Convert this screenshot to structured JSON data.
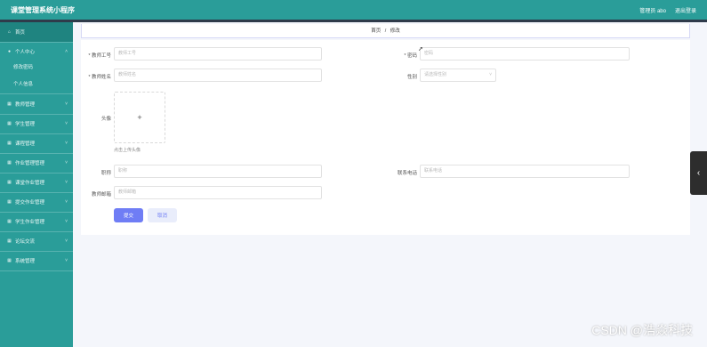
{
  "topbar": {
    "title": "课堂管理系统小程序",
    "admin_label": "管理员 abo",
    "logout_label": "退出登录"
  },
  "sidebar": {
    "items": [
      {
        "label": "首页",
        "icon": "home-icon"
      },
      {
        "label": "个人中心",
        "icon": "user-icon"
      },
      {
        "label": "修改密码"
      },
      {
        "label": "个人信息"
      },
      {
        "label": "教师管理",
        "icon": "grid-icon"
      },
      {
        "label": "学生管理",
        "icon": "grid-icon"
      },
      {
        "label": "课程管理",
        "icon": "grid-icon"
      },
      {
        "label": "作业管理管理",
        "icon": "grid-icon"
      },
      {
        "label": "课堂作业管理",
        "icon": "grid-icon"
      },
      {
        "label": "提交作业管理",
        "icon": "grid-icon"
      },
      {
        "label": "学生作业管理",
        "icon": "grid-icon"
      },
      {
        "label": "论坛交流",
        "icon": "grid-icon"
      },
      {
        "label": "系统管理",
        "icon": "grid-icon"
      }
    ]
  },
  "breadcrumb": {
    "home": "首页",
    "separator": "/",
    "current": "修改"
  },
  "form": {
    "teacher_id": {
      "label": "* 教师工号",
      "placeholder": "教师工号"
    },
    "password": {
      "label": "* 密码",
      "placeholder": "密码"
    },
    "teacher_name": {
      "label": "* 教师姓名",
      "placeholder": "教师姓名"
    },
    "gender": {
      "label": "性别",
      "placeholder": "请选择性别"
    },
    "avatar": {
      "label": "头像",
      "plus": "+",
      "tip": "点击上传头像"
    },
    "title": {
      "label": "职称",
      "placeholder": "职称"
    },
    "phone": {
      "label": "联系电话",
      "placeholder": "联系电话"
    },
    "email": {
      "label": "教师邮箱",
      "placeholder": "教师邮箱"
    },
    "submit_label": "提交",
    "cancel_label": "取消"
  },
  "side_tab": {
    "icon": "chevron-left-icon",
    "glyph": "‹"
  },
  "watermark": "CSDN @浩焱科技",
  "colors": {
    "sidebar": "#2a9d99",
    "submit": "#6f7df5"
  }
}
